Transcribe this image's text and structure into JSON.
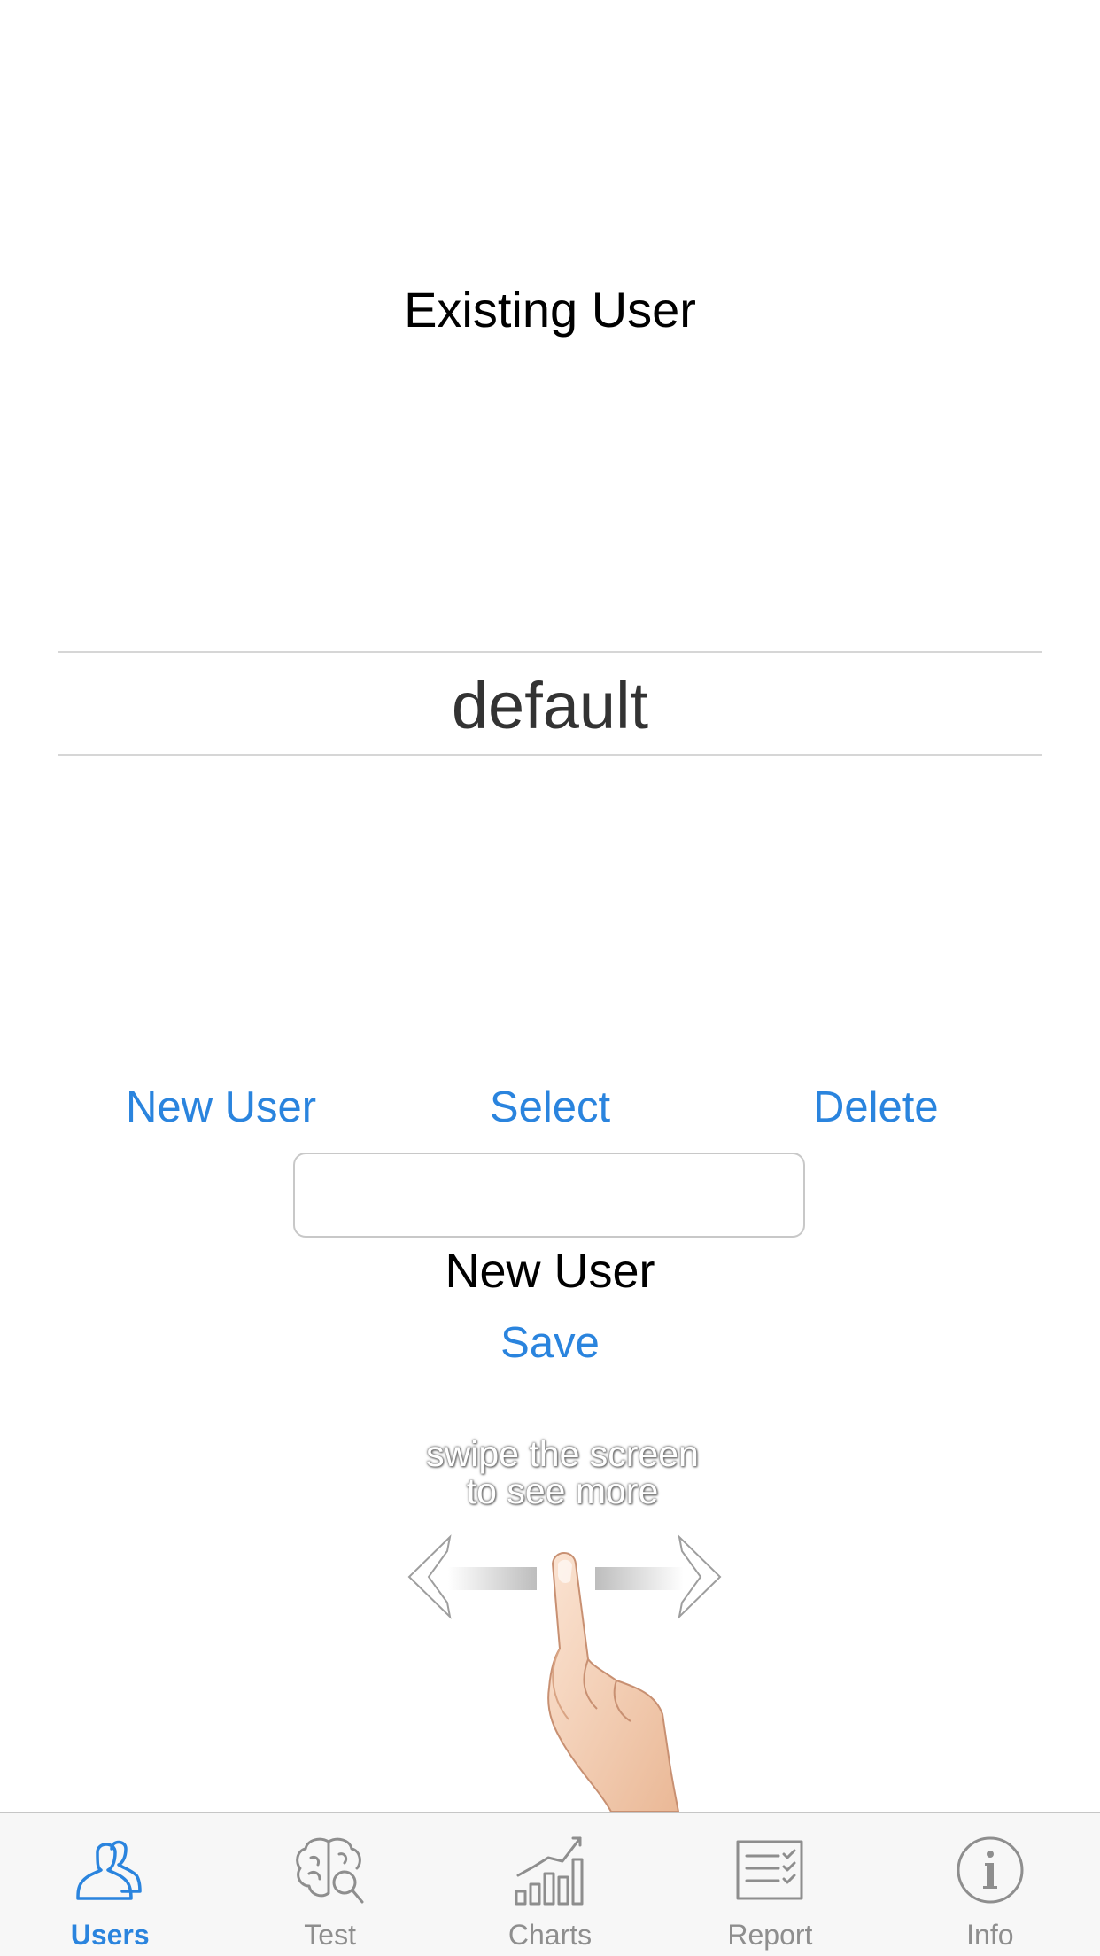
{
  "header": {
    "title": "Existing User"
  },
  "picker": {
    "selected_value": "default"
  },
  "actions": {
    "new_user_label": "New User",
    "select_label": "Select",
    "delete_label": "Delete"
  },
  "new_user_form": {
    "input_value": "",
    "input_placeholder": "",
    "label": "New User",
    "save_label": "Save"
  },
  "swipe_hint": {
    "line1": "swipe the screen",
    "line2": "to see more"
  },
  "tabbar": {
    "active_tab": "Users",
    "accent_color": "#2a84de",
    "inactive_color": "#8e8e8e",
    "items": [
      {
        "label": "Users",
        "icon": "users-icon"
      },
      {
        "label": "Test",
        "icon": "brain-search-icon"
      },
      {
        "label": "Charts",
        "icon": "bar-chart-icon"
      },
      {
        "label": "Report",
        "icon": "report-checklist-icon"
      },
      {
        "label": "Info",
        "icon": "info-icon"
      }
    ]
  }
}
